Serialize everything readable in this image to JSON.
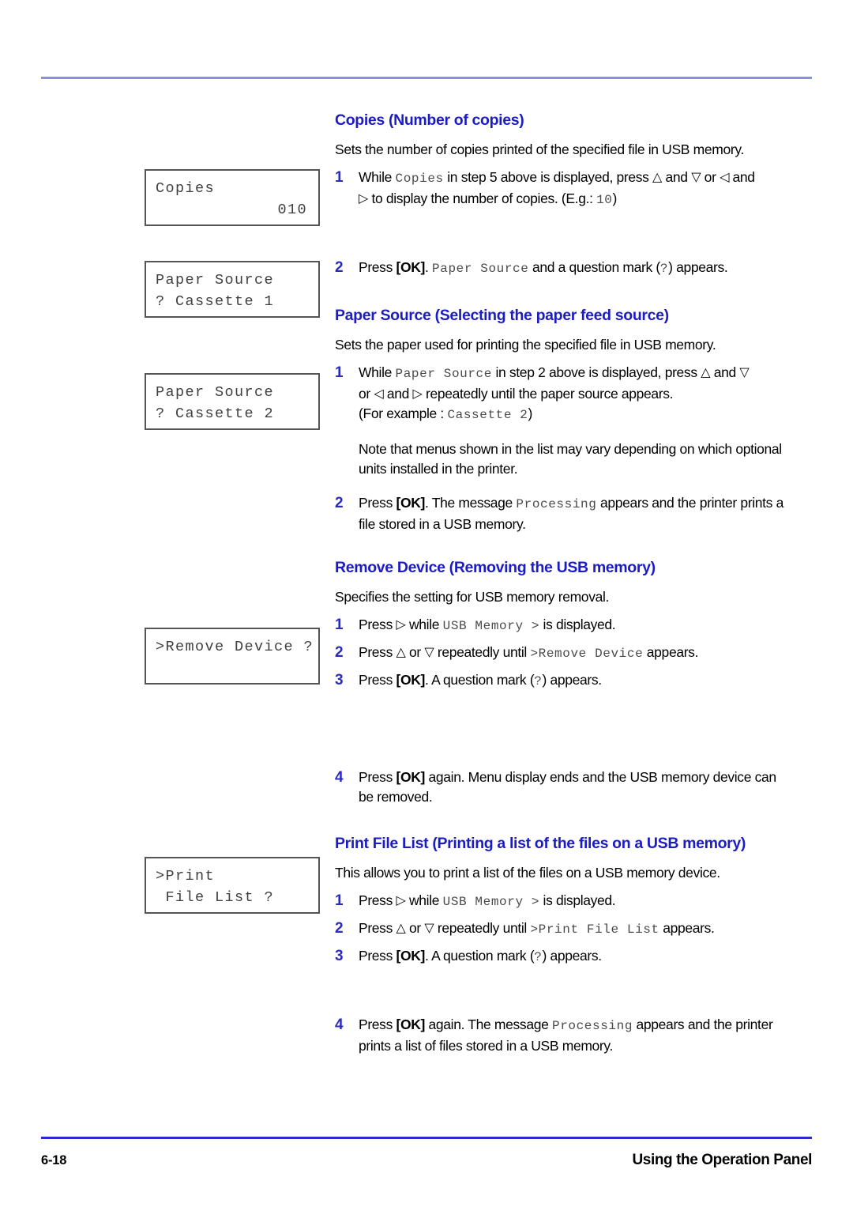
{
  "rules": {
    "top_color": "#8a90de",
    "bottom_color": "#2a2ad0"
  },
  "footer": {
    "page_number": "6-18",
    "section_title": "Using the Operation Panel"
  },
  "colors": {
    "heading_blue": "#1c1cc4",
    "step_number_blue": "#2b2bbe",
    "lcd_text": "#3f3f3f",
    "lcd_border": "#555555"
  },
  "lcd_panels": [
    {
      "id": "lcd-copies",
      "name": "lcd-display-copies",
      "line1": "Copies",
      "line2": "010",
      "line2_align": "right"
    },
    {
      "id": "lcd-paper-src-1",
      "name": "lcd-display-paper-source-cassette-1",
      "line1": "Paper Source",
      "line2": "? Cassette 1",
      "line2_align": "left"
    },
    {
      "id": "lcd-paper-src-2",
      "name": "lcd-display-paper-source-cassette-2",
      "line1": "Paper Source",
      "line2": "? Cassette 2",
      "line2_align": "left"
    },
    {
      "id": "lcd-remove-dev",
      "name": "lcd-display-remove-device",
      "line1": ">Remove Device ?",
      "line2": "",
      "line2_align": "left"
    },
    {
      "id": "lcd-print-list",
      "name": "lcd-display-print-file-list",
      "line1": ">Print",
      "line2": " File List ?",
      "line2_align": "left"
    }
  ],
  "sections": {
    "copies": {
      "heading": "Copies (Number of copies)",
      "intro": "Sets the number of copies printed of the specified file in USB memory.",
      "step1_num": "1",
      "step1_a": "While ",
      "step1_mono_copies": "Copies",
      "step1_b": " in step 5 above is displayed, press ",
      "step1_tri_up": "△",
      "step1_c": " and ",
      "step1_tri_down": "▽",
      "step1_d": " or ",
      "step1_tri_left": "◁",
      "step1_e": " and",
      "step1_f": " to display the number of copies. (E.g.: ",
      "step1_tri_right": "▷",
      "step1_mono_10": "10",
      "step1_g": ")",
      "step2_num": "2",
      "step2_a": "Press ",
      "step2_ok": "[OK]",
      "step2_b": ". ",
      "step2_mono_paper_source": "Paper Source",
      "step2_c": " and a question mark (",
      "step2_mono_q": "?",
      "step2_d": ") appears."
    },
    "paper_source": {
      "heading": "Paper Source (Selecting the paper feed source)",
      "intro": "Sets the paper used for printing the specified file in USB memory.",
      "step1_num": "1",
      "step1_a": "While ",
      "step1_mono_paper_source": "Paper Source",
      "step1_b": " in step 2 above is displayed, press ",
      "step1_tri_up": "△",
      "step1_c": " and ",
      "step1_tri_down": "▽",
      "step1_d": "or ",
      "step1_tri_left": "◁",
      "step1_e": " and ",
      "step1_tri_right": "▷",
      "step1_f": " repeatedly until the paper source appears.",
      "step1_g": "(For example : ",
      "step1_mono_cassette2": "Cassette 2",
      "step1_h": ")",
      "note": "Note that menus shown in the list may vary depending on which optional units installed in the printer.",
      "step2_num": "2",
      "step2_a": "Press ",
      "step2_ok": "[OK]",
      "step2_b": ". The message ",
      "step2_mono_processing": "Processing",
      "step2_c": " appears and the printer prints a file stored in a USB memory."
    },
    "remove_device": {
      "heading": "Remove Device (Removing the USB memory)",
      "intro": "Specifies the setting for USB memory removal.",
      "step1_num": "1",
      "step1_a": "Press ",
      "step1_tri_right": "▷",
      "step1_b": " while ",
      "step1_mono_usb": "USB Memory >",
      "step1_c": " is displayed.",
      "step2_num": "2",
      "step2_a": "Press ",
      "step2_tri_up": "△",
      "step2_b": " or ",
      "step2_tri_down": "▽",
      "step2_c": " repeatedly until ",
      "step2_mono_remove": ">Remove Device",
      "step2_d": " appears.",
      "step3_num": "3",
      "step3_a": "Press ",
      "step3_ok": "[OK]",
      "step3_b": ". A question mark (",
      "step3_mono_q": "?",
      "step3_c": ") appears.",
      "step4_num": "4",
      "step4_a": "Press ",
      "step4_ok": "[OK]",
      "step4_b": " again. Menu display ends and the USB memory device can be removed."
    },
    "print_file_list": {
      "heading": "Print File List (Printing a list of the files on a USB memory)",
      "intro": "This allows you to print a list of the files on a USB memory device.",
      "step1_num": "1",
      "step1_a": "Press ",
      "step1_tri_right": "▷",
      "step1_b": " while ",
      "step1_mono_usb": "USB Memory >",
      "step1_c": " is displayed.",
      "step2_num": "2",
      "step2_a": "Press ",
      "step2_tri_up": "△",
      "step2_b": " or ",
      "step2_tri_down": "▽",
      "step2_c": " repeatedly until ",
      "step2_mono_print": ">Print File List",
      "step2_d": " appears.",
      "step3_num": "3",
      "step3_a": "Press ",
      "step3_ok": "[OK]",
      "step3_b": ". A question mark (",
      "step3_mono_q": "?",
      "step3_c": ") appears.",
      "step4_num": "4",
      "step4_a": "Press ",
      "step4_ok": "[OK]",
      "step4_b": " again. The message ",
      "step4_mono_processing": "Processing",
      "step4_c": " appears and the printer prints a list of files stored in a USB memory."
    }
  }
}
